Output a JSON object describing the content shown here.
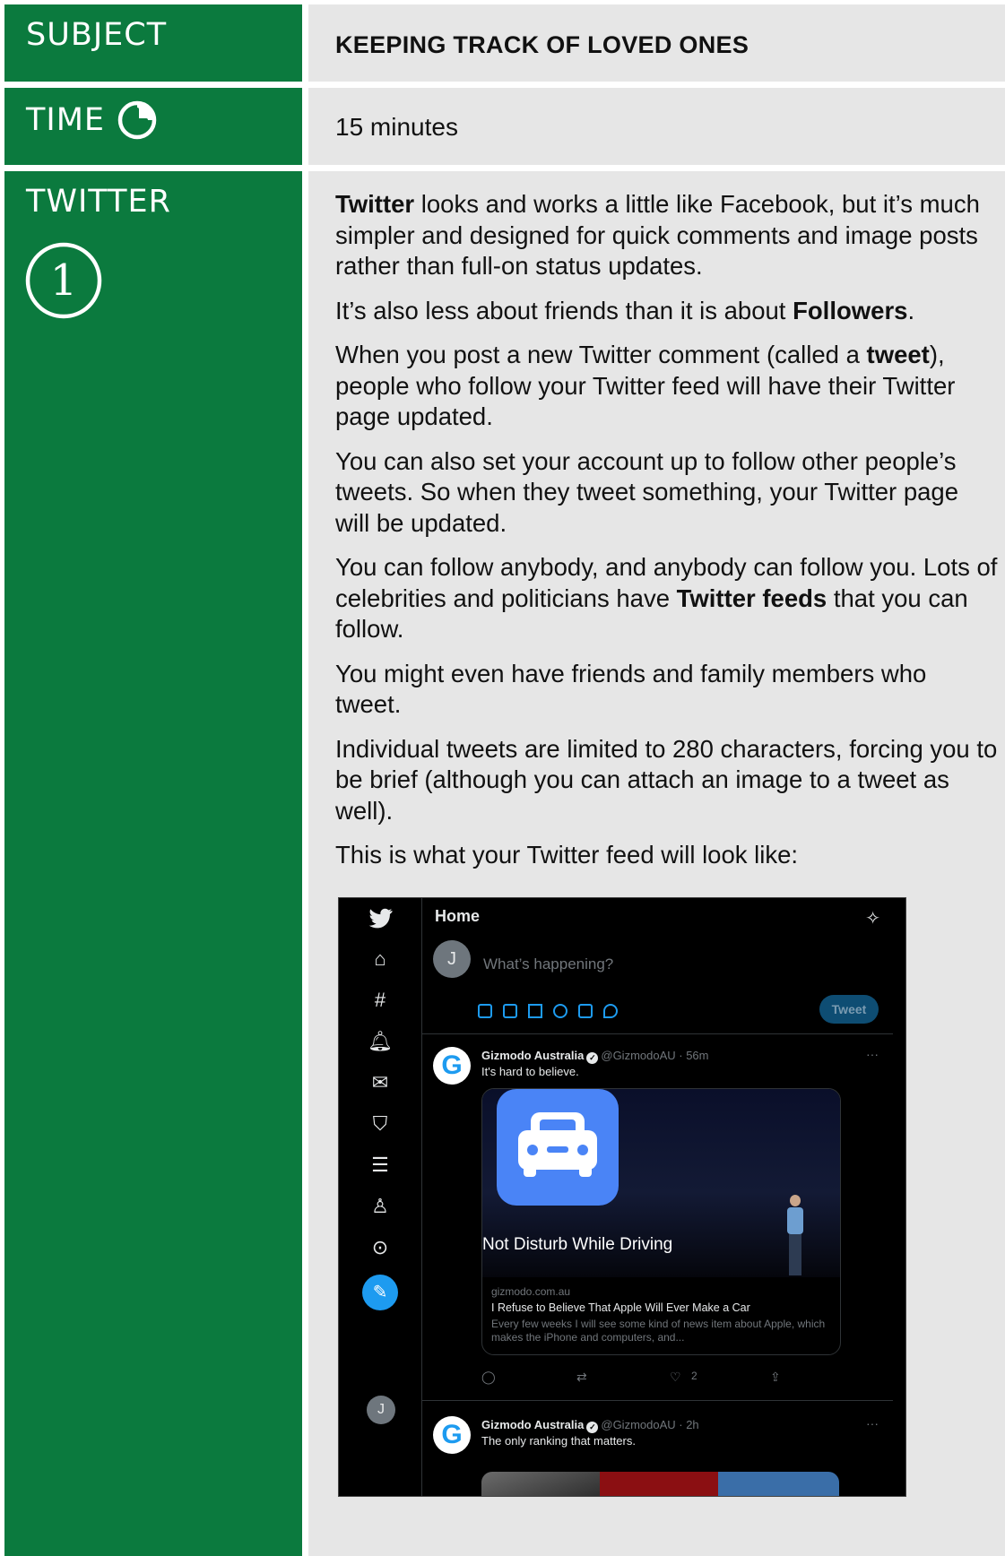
{
  "rows": {
    "subject": {
      "label": "SUBJECT",
      "value": "KEEPING TRACK OF LOVED ONES"
    },
    "time": {
      "label": "TIME",
      "value": "15 minutes"
    },
    "section": {
      "label": "TWITTER",
      "step": "1"
    }
  },
  "paragraphs": [
    {
      "bold": "Twitter",
      "rest": " looks and works a little like Facebook, but it’s much simpler and designed for quick comments and image posts rather than full-on status updates."
    },
    {
      "pre": "It’s also less about friends than it is about ",
      "bold": "Followers",
      "post": "."
    },
    {
      "pre": "When you post a new Twitter comment (called a ",
      "bold": "tweet",
      "post": "), people who follow your Twitter feed will have their Twitter page updated."
    },
    {
      "text": "You can also set your account up to follow other people’s tweets. So when they tweet something, your Twitter page will be updated."
    },
    {
      "pre": "You can follow anybody, and anybody can follow you. Lots of celebrities and politicians have ",
      "bold": "Twitter feeds",
      "post": " that you can follow."
    },
    {
      "text": "You might even have friends and family members who tweet."
    },
    {
      "text": "Individual tweets are limited to 280 characters, forcing you to be brief (although you can attach an image to a tweet as well)."
    },
    {
      "text": "This is what your Twitter feed will look like:"
    }
  ],
  "twitter": {
    "header": "Home",
    "avatar_letter": "J",
    "compose_placeholder": "What’s happening?",
    "tweet_button": "Tweet",
    "tweets": [
      {
        "name": "Gizmodo Australia",
        "handle": "@GizmodoAU · 56m",
        "text": "It's hard to believe.",
        "card": {
          "slide_text": "Not Disturb While Driving",
          "domain": "gizmodo.com.au",
          "title": "I Refuse to Believe That Apple Will Ever Make a Car",
          "description": "Every few weeks I will see some kind of news item about Apple, which makes the iPhone and computers, and..."
        },
        "likes": "2"
      },
      {
        "name": "Gizmodo Australia",
        "handle": "@GizmodoAU · 2h",
        "text": "The only ranking that matters."
      }
    ],
    "more": "···",
    "logo_letter": "G"
  }
}
